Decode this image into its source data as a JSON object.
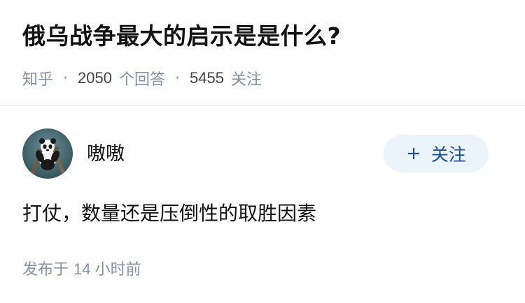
{
  "question": {
    "title": "俄乌战争最大的启示是是什么?",
    "source": "知乎",
    "answer_count": "2050",
    "answer_label": "个回答",
    "follower_count": "5455",
    "follower_label": "关注",
    "separator": "·"
  },
  "answer": {
    "author_name": "嗷嗷",
    "follow_plus": "+",
    "follow_label": "关注",
    "content": "打仗，数量还是压倒性的取胜因素",
    "published_prefix": "发布于",
    "published_value": "14 小时前"
  },
  "colors": {
    "meta_gray": "#8590a6",
    "follow_bg": "#ebf3fb",
    "follow_text": "#175199",
    "divider": "#ebebeb"
  },
  "icons": {
    "avatar": "panda-avatar"
  }
}
